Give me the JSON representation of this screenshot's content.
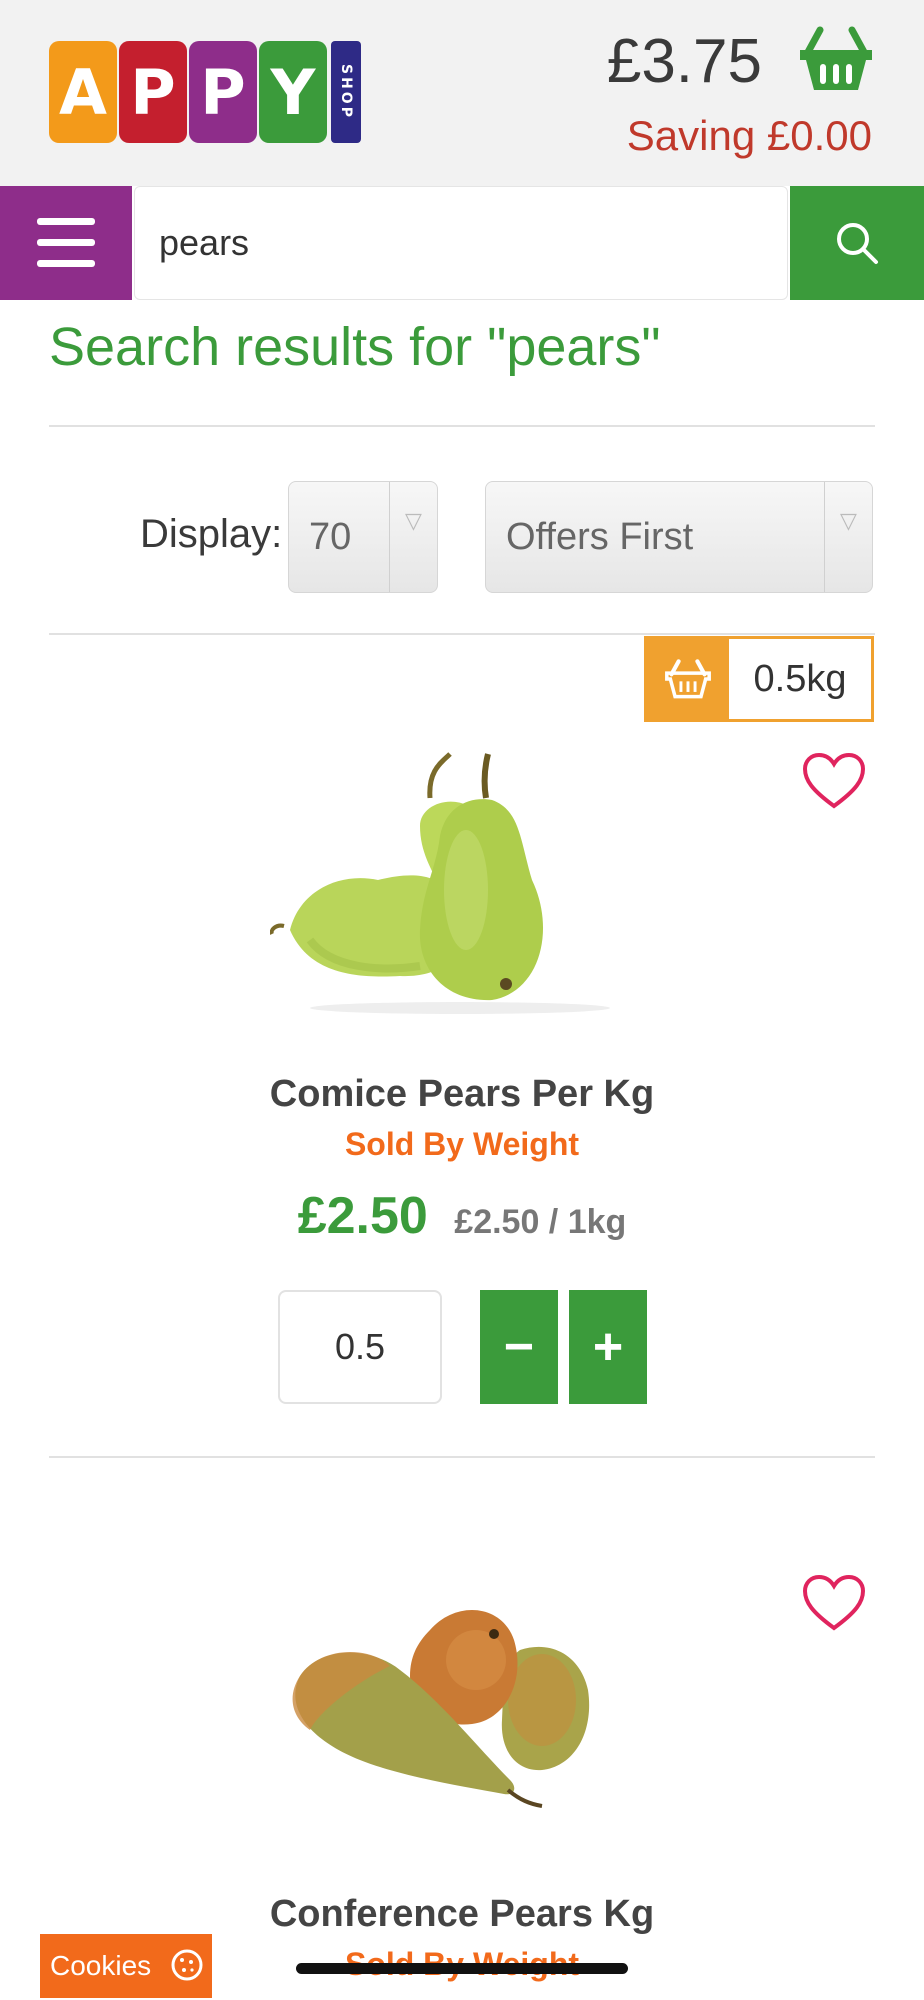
{
  "logo": {
    "letters": [
      "A",
      "P",
      "P",
      "Y"
    ],
    "colors": [
      "#f39a1a",
      "#c41f2e",
      "#8e2d8a",
      "#3b9b3b"
    ],
    "shop_text": "SHOP"
  },
  "cart": {
    "total": "£3.75",
    "saving": "Saving £0.00",
    "icon": "basket-icon"
  },
  "search": {
    "value": "pears",
    "placeholder": "",
    "menu_icon": "hamburger-icon",
    "search_icon": "search-icon"
  },
  "results_title": "Search results for \"pears\"",
  "controls": {
    "display_label": "Display:",
    "display_value": "70",
    "sort_value": "Offers First"
  },
  "products": [
    {
      "basket_qty": "0.5kg",
      "name": "Comice Pears Per Kg",
      "sold_by": "Sold By Weight",
      "price": "£2.50",
      "unit_price": "£2.50 / 1kg",
      "quantity": "0.5",
      "minus_label": "−",
      "plus_label": "+"
    },
    {
      "name": "Conference Pears Kg",
      "sold_by": "Sold By Weight"
    }
  ],
  "cookies_label": "Cookies",
  "colors": {
    "green": "#3b9b3b",
    "purple": "#8e2d8a",
    "orange": "#f26a1b",
    "basket_orange": "#f0a12f",
    "saving_red": "#c0392b",
    "heart_pink": "#e0245e"
  }
}
